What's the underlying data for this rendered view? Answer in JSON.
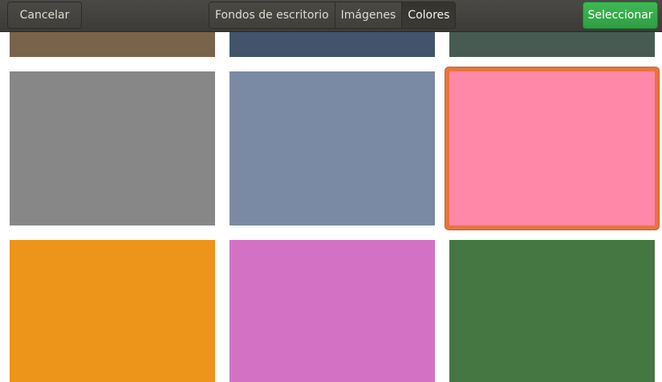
{
  "header": {
    "cancel_label": "Cancelar",
    "select_label": "Seleccionar",
    "tabs": [
      {
        "label": "Fondos de escritorio",
        "active": false
      },
      {
        "label": "Imágenes",
        "active": false
      },
      {
        "label": "Colores",
        "active": true
      }
    ]
  },
  "colors": {
    "row0": [
      "#7a634b",
      "#41546b",
      "#475b52"
    ],
    "row1": [
      "#878787",
      "#7a8aa4",
      "#ff88a8"
    ],
    "row2": [
      "#ed941b",
      "#d372c4",
      "#457742"
    ],
    "selected": "#ff88a8",
    "selection_border": "#e9733f",
    "accent_green": "#34a849"
  }
}
